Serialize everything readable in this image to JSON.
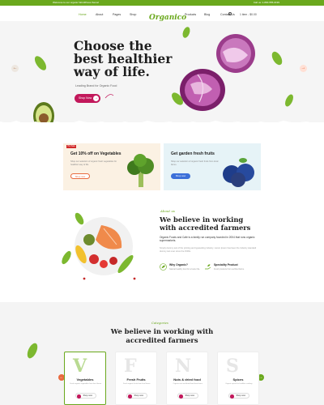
{
  "topbar": {
    "left_text": "Welcome to our organic WordPress theme!",
    "right_text": "Call us: 1-800-555-0199"
  },
  "nav": {
    "items": [
      "Home",
      "About",
      "Pages",
      "Shop",
      "Products",
      "Blog",
      "Contact Us"
    ],
    "logo": "Organico",
    "cart": "1 item - $0.00"
  },
  "hero": {
    "title": "Choose the best healthier way of life.",
    "subtitle": "Leading Brand for Organic Food",
    "button": "Shop Now"
  },
  "promos": [
    {
      "badge": "Hot Sale",
      "title": "Get 10% off on Vegetables",
      "text": "Shop our selection of organic fresh vegetables for healthier way of life.",
      "button": "Shop now"
    },
    {
      "title": "Get garden fresh fruits",
      "text": "Shop our selection of organic fresh fruits from local farms.",
      "button": "Shop now"
    }
  ],
  "about": {
    "kicker": "About us",
    "title": "We believe in working with accredited farmers",
    "lead": "Organic Foods and Cafe is a family run company founded in 2004 that runs organic supermarkets.",
    "body": "Simply dummy text of the printing and typesetting industry. Lorem Ipsum has been the industry standard dummy text ever since the 1500s.",
    "features": [
      {
        "title": "Why Organic?",
        "text": "Natural healthy food for a better life."
      },
      {
        "title": "Speciality Product",
        "text": "Fresh products from certified farms."
      }
    ]
  },
  "categories": {
    "kicker": "Categories",
    "title": "We believe in working with accredited farmers",
    "items": [
      {
        "letter": "V",
        "name": "Vegetables",
        "desc": "Fresh organic vegetables from local farms.",
        "button": "Shop now"
      },
      {
        "letter": "F",
        "name": "Fresh Fruits",
        "desc": "Fresh organic fruits from local farms.",
        "button": "Shop now"
      },
      {
        "letter": "N",
        "name": "Nuts & dried food",
        "desc": "Organic nuts and dried food from farms.",
        "button": "Shop now"
      },
      {
        "letter": "S",
        "name": "Spices",
        "desc": "Organic spices for healthier cooking.",
        "button": "Shop now"
      }
    ]
  },
  "colors": {
    "brand_green": "#6aa81d",
    "accent_pink": "#c2185b",
    "accent_orange": "#e96a3e",
    "accent_blue": "#3b6fd9"
  }
}
